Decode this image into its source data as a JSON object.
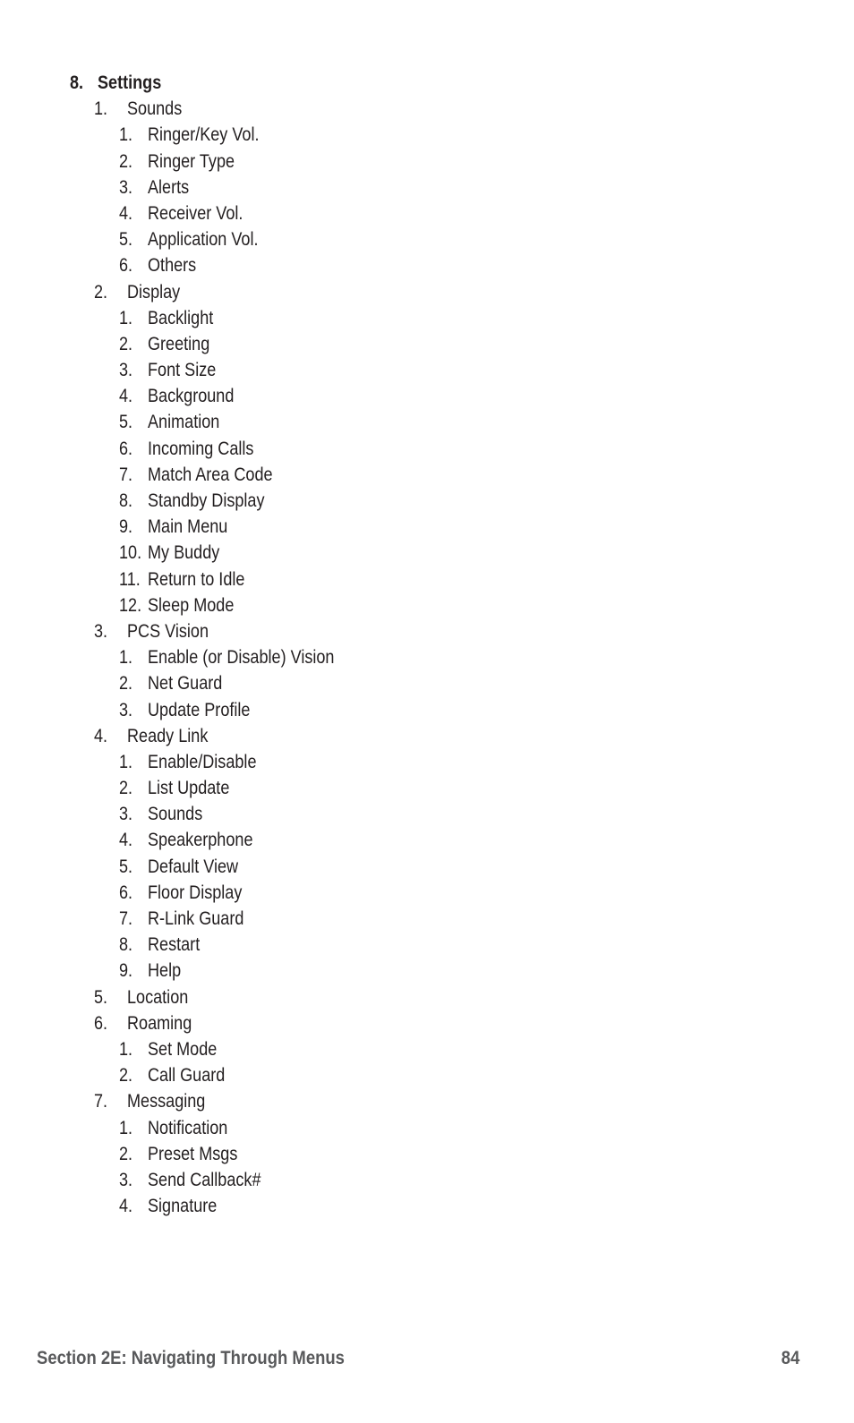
{
  "document": {
    "page_number": "84",
    "footer_section": "Section 2E: Navigating Through Menus",
    "text_color": "#231f20",
    "footer_color": "#58595b",
    "background_color": "#ffffff"
  },
  "outline": [
    {
      "level": 1,
      "number": "8.",
      "label": "Settings"
    },
    {
      "level": 2,
      "number": "1.",
      "label": "Sounds"
    },
    {
      "level": 3,
      "number": "1.",
      "label": "Ringer/Key Vol."
    },
    {
      "level": 3,
      "number": "2.",
      "label": "Ringer Type"
    },
    {
      "level": 3,
      "number": "3.",
      "label": "Alerts"
    },
    {
      "level": 3,
      "number": "4.",
      "label": "Receiver Vol."
    },
    {
      "level": 3,
      "number": "5.",
      "label": "Application Vol."
    },
    {
      "level": 3,
      "number": "6.",
      "label": "Others"
    },
    {
      "level": 2,
      "number": "2.",
      "label": "Display"
    },
    {
      "level": 3,
      "number": "1.",
      "label": "Backlight"
    },
    {
      "level": 3,
      "number": "2.",
      "label": "Greeting"
    },
    {
      "level": 3,
      "number": "3.",
      "label": "Font Size"
    },
    {
      "level": 3,
      "number": "4.",
      "label": "Background"
    },
    {
      "level": 3,
      "number": "5.",
      "label": "Animation"
    },
    {
      "level": 3,
      "number": "6.",
      "label": "Incoming Calls"
    },
    {
      "level": 3,
      "number": "7.",
      "label": "Match Area Code"
    },
    {
      "level": 3,
      "number": "8.",
      "label": "Standby Display"
    },
    {
      "level": 3,
      "number": "9.",
      "label": "Main Menu"
    },
    {
      "level": 3,
      "number": "10.",
      "label": "My Buddy"
    },
    {
      "level": 3,
      "number": "11.",
      "label": "Return to Idle"
    },
    {
      "level": 3,
      "number": "12.",
      "label": "Sleep Mode"
    },
    {
      "level": 2,
      "number": "3.",
      "label": "PCS Vision"
    },
    {
      "level": 3,
      "number": "1.",
      "label": "Enable (or Disable) Vision"
    },
    {
      "level": 3,
      "number": "2.",
      "label": "Net Guard"
    },
    {
      "level": 3,
      "number": "3.",
      "label": "Update Profile"
    },
    {
      "level": 2,
      "number": "4.",
      "label": "Ready Link"
    },
    {
      "level": 3,
      "number": "1.",
      "label": "Enable/Disable"
    },
    {
      "level": 3,
      "number": "2.",
      "label": "List Update"
    },
    {
      "level": 3,
      "number": "3.",
      "label": "Sounds"
    },
    {
      "level": 3,
      "number": "4.",
      "label": "Speakerphone"
    },
    {
      "level": 3,
      "number": "5.",
      "label": "Default View"
    },
    {
      "level": 3,
      "number": "6.",
      "label": "Floor Display"
    },
    {
      "level": 3,
      "number": "7.",
      "label": "R-Link Guard"
    },
    {
      "level": 3,
      "number": "8.",
      "label": "Restart"
    },
    {
      "level": 3,
      "number": "9.",
      "label": "Help"
    },
    {
      "level": 2,
      "number": "5.",
      "label": "Location"
    },
    {
      "level": 2,
      "number": "6.",
      "label": "Roaming"
    },
    {
      "level": 3,
      "number": "1.",
      "label": "Set Mode"
    },
    {
      "level": 3,
      "number": "2.",
      "label": "Call Guard"
    },
    {
      "level": 2,
      "number": "7.",
      "label": "Messaging"
    },
    {
      "level": 3,
      "number": "1.",
      "label": "Notification"
    },
    {
      "level": 3,
      "number": "2.",
      "label": "Preset Msgs"
    },
    {
      "level": 3,
      "number": "3.",
      "label": "Send Callback#"
    },
    {
      "level": 3,
      "number": "4.",
      "label": "Signature"
    }
  ]
}
